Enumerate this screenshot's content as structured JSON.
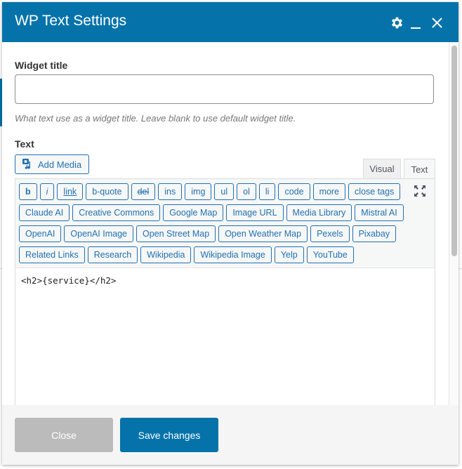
{
  "dialog": {
    "title": "WP Text Settings",
    "icons": {
      "settings": "gear-icon",
      "minimize": "minimize-icon",
      "close": "close-icon"
    },
    "accent_color": "#0573aa"
  },
  "widget_title": {
    "label": "Widget title",
    "value": "",
    "placeholder": "",
    "hint": "What text use as a widget title. Leave blank to use default widget title."
  },
  "text": {
    "label": "Text",
    "add_media_label": "Add Media",
    "tabs": {
      "visual": "Visual",
      "text": "Text"
    },
    "active_tab": "Text",
    "quicktags": [
      [
        "b",
        "i",
        "link",
        "b-quote",
        "del",
        "ins",
        "img",
        "ul",
        "ol",
        "li",
        "code",
        "more",
        "close tags"
      ],
      [
        "Claude AI",
        "Creative Commons",
        "Google Map",
        "Image URL",
        "Media Library",
        "Mistral AI"
      ],
      [
        "OpenAI",
        "OpenAI Image",
        "Open Street Map",
        "Open Weather Map",
        "Pexels",
        "Pixabay"
      ],
      [
        "Related Links",
        "Research",
        "Wikipedia",
        "Wikipedia Image",
        "Yelp",
        "YouTube"
      ]
    ],
    "content": "<h2>{service}</h2>"
  },
  "footer": {
    "close_label": "Close",
    "save_label": "Save changes"
  }
}
